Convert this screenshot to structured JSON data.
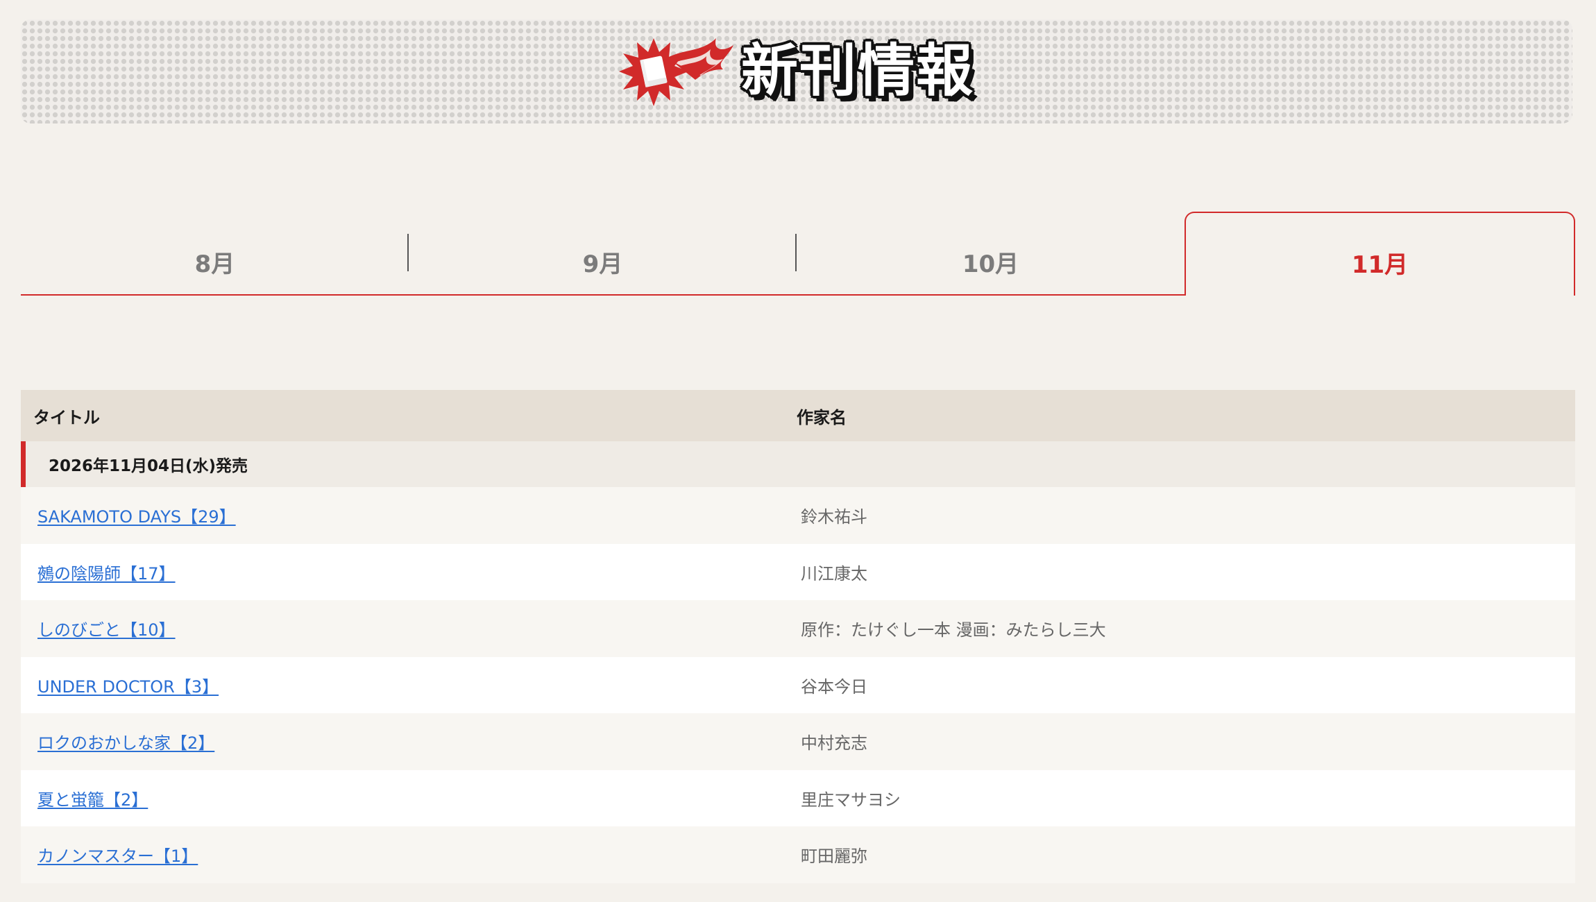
{
  "banner": {
    "title": "新刊情報",
    "icon": "flaming-book-icon",
    "colors": {
      "flame": "#d12a2a",
      "book": "#ffffff"
    }
  },
  "tabs": [
    {
      "label": "8月",
      "active": false
    },
    {
      "label": "9月",
      "active": false
    },
    {
      "label": "10月",
      "active": false
    },
    {
      "label": "11月",
      "active": true
    }
  ],
  "table": {
    "columns": {
      "title": "タイトル",
      "author": "作家名"
    },
    "date_group": "2026年11月04日(水)発売",
    "rows": [
      {
        "title": "SAKAMOTO DAYS【29】",
        "author": "鈴木祐斗"
      },
      {
        "title": "鵺の陰陽師【17】",
        "author": "川江康太"
      },
      {
        "title": "しのびごと【10】",
        "author": "原作：たけぐし一本 漫画：みたらし三大"
      },
      {
        "title": "UNDER DOCTOR【3】",
        "author": "谷本今日"
      },
      {
        "title": "ロクのおかしな家【2】",
        "author": "中村充志"
      },
      {
        "title": "夏と蛍籠【2】",
        "author": "里庄マサヨシ"
      },
      {
        "title": "カノンマスター【1】",
        "author": "町田麗弥"
      }
    ]
  },
  "colors": {
    "accent": "#d12a2a",
    "link": "#2a6fd4",
    "page_bg": "#f4f1ec",
    "header_bg": "#e6dfd5"
  }
}
